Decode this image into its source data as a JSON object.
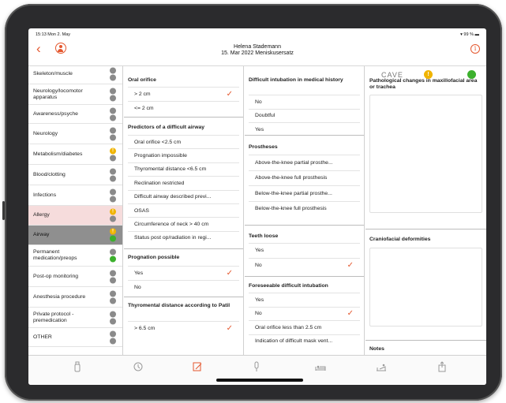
{
  "status": {
    "time": "15:13  Mon 2. May",
    "battery": "▾ 99 % ▬"
  },
  "header": {
    "patient": "Helena Stademann",
    "subtitle": "15. Mar 2022  Meniskusersatz",
    "back_icon": "chevron-left-icon",
    "avatar_icon": "user-icon",
    "info_icon": "info-icon",
    "info_glyph": "i"
  },
  "colors": {
    "accent": "#e4572e",
    "yellow": "#f0b400",
    "green": "#3cb02d",
    "gray": "#8a8a8a"
  },
  "sidebar": {
    "items": [
      {
        "label": "Skeleton/muscle",
        "dots": [
          "gray",
          "gray"
        ]
      },
      {
        "label": "Neurology/locomotor apparatus",
        "dots": [
          "gray",
          "gray"
        ]
      },
      {
        "label": "Awareness/psyche",
        "dots": [
          "gray",
          "gray"
        ]
      },
      {
        "label": "Neurology",
        "dots": [
          "gray",
          "gray"
        ]
      },
      {
        "label": "Metabolism/diabetes",
        "dots": [
          "yellow",
          "gray"
        ]
      },
      {
        "label": "Blood/clotting",
        "dots": [
          "gray",
          "gray"
        ]
      },
      {
        "label": "Infections",
        "dots": [
          "gray",
          "gray"
        ]
      },
      {
        "label": "Allergy",
        "dots": [
          "yellow",
          "gray"
        ]
      },
      {
        "label": "Airway",
        "dots": [
          "yellow",
          "green"
        ]
      },
      {
        "label": "Permanent medication/preops",
        "dots": [
          "gray",
          "green"
        ]
      },
      {
        "label": "Post-op monitoring",
        "dots": [
          "gray",
          "gray"
        ]
      },
      {
        "label": "Anesthesia procedure",
        "dots": [
          "gray",
          "gray"
        ]
      },
      {
        "label": "Private protocol - premedication",
        "dots": [
          "gray",
          "gray"
        ]
      },
      {
        "label": "OTHER",
        "dots": [
          "gray",
          "gray"
        ]
      }
    ]
  },
  "cave": {
    "label": "CAVE",
    "warning_glyph": "!"
  },
  "col1": {
    "oral_orifice": {
      "title": "Oral orifice",
      "options": [
        {
          "label": "> 2 cm",
          "checked": true
        },
        {
          "label": "<= 2 cm",
          "checked": false
        }
      ]
    },
    "predictors": {
      "title": "Predictors of a difficult airway",
      "options": [
        {
          "label": "Oral orifice <2.5 cm"
        },
        {
          "label": "Prognation impossible"
        },
        {
          "label": "Thyromental distance <6.5 cm"
        },
        {
          "label": "Reclination restricted"
        },
        {
          "label": "Difficult airway described previ..."
        },
        {
          "label": "OSAS"
        },
        {
          "label": "Circumference of neck > 40 cm"
        },
        {
          "label": "Status post op/radiation in regi..."
        }
      ]
    },
    "prognation": {
      "title": "Prognation possible",
      "options": [
        {
          "label": "Yes",
          "checked": true
        },
        {
          "label": "No",
          "checked": false
        }
      ]
    },
    "thyromental": {
      "title": "Thyromental distance according to Patil",
      "options": [
        {
          "label": "> 6.5 cm",
          "checked": true
        }
      ]
    }
  },
  "col2": {
    "difficult_history": {
      "title": "Difficult intubation in medical history",
      "options": [
        {
          "label": "No"
        },
        {
          "label": "Doubtful"
        },
        {
          "label": "Yes"
        }
      ]
    },
    "prostheses": {
      "title": "Prostheses",
      "options": [
        {
          "label": "Above-the-knee partial prosthe..."
        },
        {
          "label": "Above-the-knee full prosthesis"
        },
        {
          "label": "Below-the-knee partial prosthe..."
        },
        {
          "label": "Below-the-knee full prosthesis"
        }
      ]
    },
    "teeth_loose": {
      "title": "Teeth loose",
      "options": [
        {
          "label": "Yes",
          "checked": false
        },
        {
          "label": "No",
          "checked": true
        }
      ]
    },
    "foreseeable": {
      "title": "Foreseeable difficult intubation",
      "options": [
        {
          "label": "Yes",
          "checked": false
        },
        {
          "label": "No",
          "checked": true
        },
        {
          "label": "Oral orifice less than 2.5 cm",
          "checked": false
        },
        {
          "label": "Indication of difficult mask vent...",
          "checked": false
        }
      ]
    }
  },
  "col3": {
    "pathological": {
      "title": "Pathological changes in maxillofacial area or trachea"
    },
    "craniofacial": {
      "title": "Craniofacial deformities"
    },
    "notes": {
      "title": "Notes"
    }
  },
  "check_glyph": "✓",
  "tabbar": {
    "tabs": [
      "bottle-icon",
      "history-icon",
      "edit-icon",
      "microphone-icon",
      "bed-icon",
      "recovery-bed-icon",
      "share-icon"
    ],
    "active": "edit-icon"
  }
}
